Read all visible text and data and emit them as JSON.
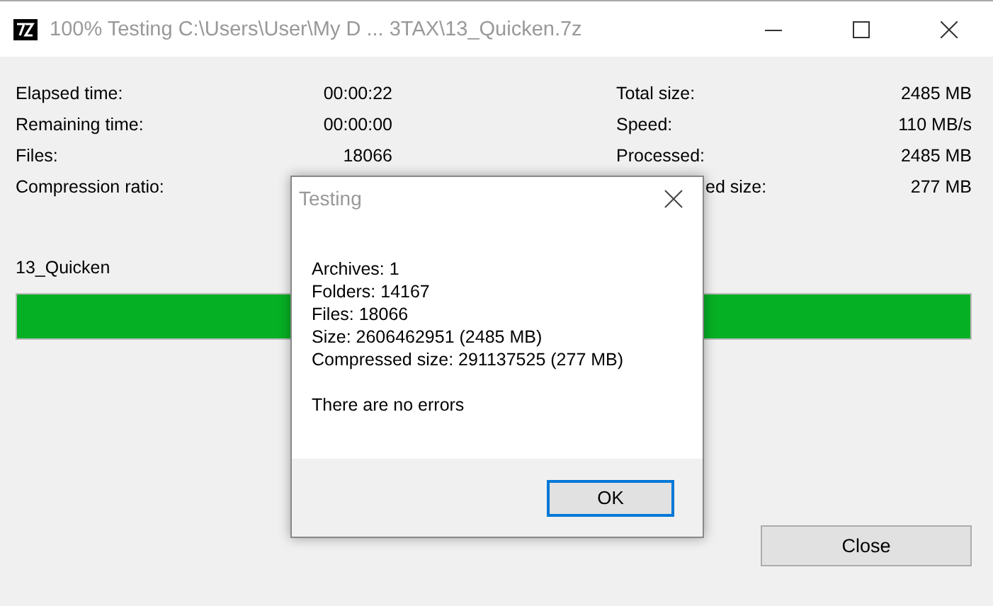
{
  "window": {
    "title": "100% Testing C:\\Users\\User\\My D ... 3TAX\\13_Quicken.7z"
  },
  "stats_left": [
    {
      "label": "Elapsed time:",
      "value": "00:00:22"
    },
    {
      "label": "Remaining time:",
      "value": "00:00:00"
    },
    {
      "label": "Files:",
      "value": "18066"
    },
    {
      "label": "Compression ratio:"
    }
  ],
  "stats_right": [
    {
      "label": "Total size:",
      "value": "2485 MB"
    },
    {
      "label": "Speed:",
      "value": "110 MB/s"
    },
    {
      "label": "Processed:",
      "value": "2485 MB"
    },
    {
      "label": "ed size:",
      "value": "277 MB",
      "partial": true
    }
  ],
  "current_file": "13_Quicken",
  "progress": {
    "level": 1
  },
  "buttons": [
    "Close"
  ],
  "dialog": {
    "title": "Testing",
    "lines": [
      "Archives: 1",
      "Folders: 14167",
      "Files: 18066",
      "Size: 2606462951 (2485 MB)",
      "Compressed size: 291137525 (277 MB)"
    ],
    "message": "There are no errors",
    "button": "OK"
  }
}
